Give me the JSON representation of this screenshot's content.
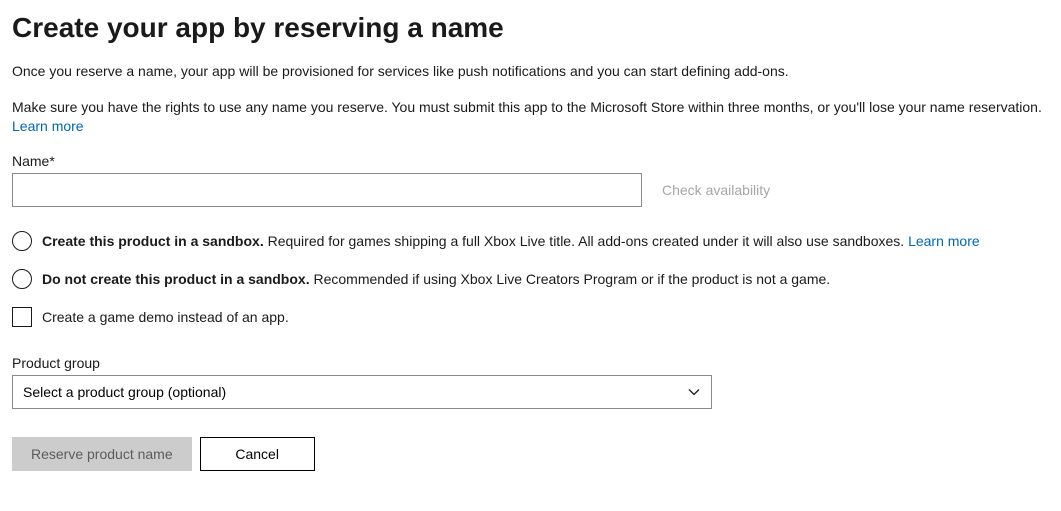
{
  "header": {
    "title": "Create your app by reserving a name"
  },
  "intro": {
    "para1": "Once you reserve a name, your app will be provisioned for services like push notifications and you can start defining add-ons.",
    "para2": "Make sure you have the rights to use any name you reserve. You must submit this app to the Microsoft Store within three months, or you'll lose your name reservation.",
    "learn_more": "Learn more"
  },
  "name_field": {
    "label": "Name",
    "required_marker": "*",
    "value": "",
    "check_availability": "Check availability"
  },
  "sandbox": {
    "option_create": {
      "bold": "Create this product in a sandbox.",
      "rest": " Required for games shipping a full Xbox Live title. All add-ons created under it will also use sandboxes. ",
      "learn_more": "Learn more"
    },
    "option_do_not": {
      "bold": "Do not create this product in a sandbox.",
      "rest": " Recommended if using Xbox Live Creators Program or if the product is not a game."
    }
  },
  "demo_checkbox": {
    "label": "Create a game demo instead of an app."
  },
  "product_group": {
    "label": "Product group",
    "placeholder": "Select a product group (optional)"
  },
  "actions": {
    "reserve": "Reserve product name",
    "cancel": "Cancel"
  }
}
